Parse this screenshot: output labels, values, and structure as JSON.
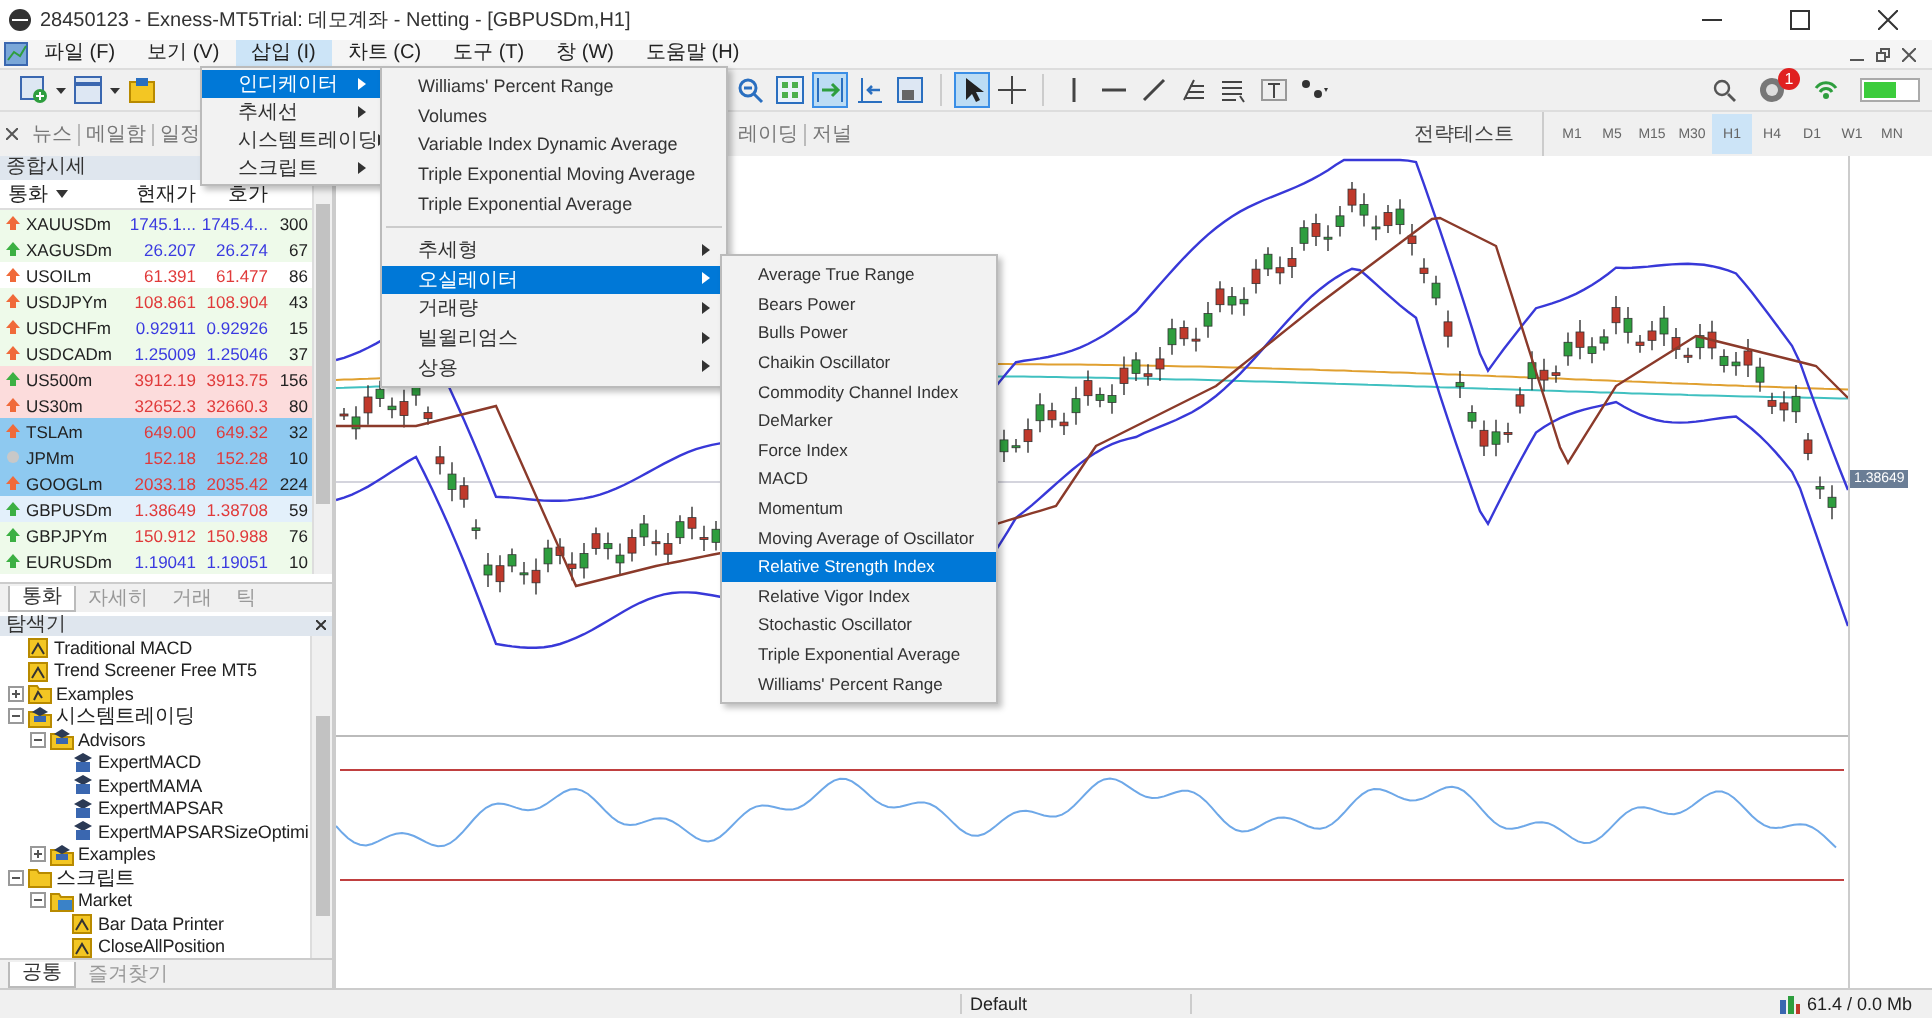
{
  "window": {
    "title": "28450123 - Exness-MT5Trial: 데모계좌 - Netting - [GBPUSDm,H1]"
  },
  "menu_bar": [
    {
      "label": "파일 (F)",
      "selected": false
    },
    {
      "label": "보기 (V)",
      "selected": false
    },
    {
      "label": "삽입 (I)",
      "selected": true
    },
    {
      "label": "차트 (C)",
      "selected": false
    },
    {
      "label": "도구 (T)",
      "selected": false
    },
    {
      "label": "창 (W)",
      "selected": false
    },
    {
      "label": "도움말 (H)",
      "selected": false
    }
  ],
  "insert_menu": {
    "items": [
      {
        "label": "인디케이터",
        "selected": true,
        "has_submenu": true
      },
      {
        "label": "추세선",
        "selected": false,
        "has_submenu": true
      },
      {
        "label": "시스템트레이딩",
        "selected": false,
        "has_submenu": true
      },
      {
        "label": "스크립트",
        "selected": false,
        "has_submenu": true
      }
    ]
  },
  "indicators_menu": {
    "items": [
      {
        "kind": "item",
        "label": "Williams' Percent Range",
        "selected": false,
        "has_submenu": false
      },
      {
        "kind": "item",
        "label": "Volumes",
        "selected": false,
        "has_submenu": false
      },
      {
        "kind": "item",
        "label": "Variable Index Dynamic Average",
        "selected": false,
        "has_submenu": false
      },
      {
        "kind": "item",
        "label": "Triple Exponential Moving Average",
        "selected": false,
        "has_submenu": false
      },
      {
        "kind": "item",
        "label": "Triple Exponential Average",
        "selected": false,
        "has_submenu": false
      },
      {
        "kind": "separator"
      },
      {
        "kind": "item",
        "label": "추세형",
        "selected": false,
        "has_submenu": true
      },
      {
        "kind": "item",
        "label": "오실레이터",
        "selected": true,
        "has_submenu": true
      },
      {
        "kind": "item",
        "label": "거래량",
        "selected": false,
        "has_submenu": true
      },
      {
        "kind": "item",
        "label": "빌윌리엄스",
        "selected": false,
        "has_submenu": true
      },
      {
        "kind": "item",
        "label": "상용",
        "selected": false,
        "has_submenu": true
      }
    ]
  },
  "oscillators_menu": {
    "items": [
      {
        "label": "Average True Range",
        "selected": false
      },
      {
        "label": "Bears Power",
        "selected": false
      },
      {
        "label": "Bulls Power",
        "selected": false
      },
      {
        "label": "Chaikin Oscillator",
        "selected": false
      },
      {
        "label": "Commodity Channel Index",
        "selected": false
      },
      {
        "label": "DeMarker",
        "selected": false
      },
      {
        "label": "Force Index",
        "selected": false
      },
      {
        "label": "MACD",
        "selected": false
      },
      {
        "label": "Momentum",
        "selected": false
      },
      {
        "label": "Moving Average of Oscillator",
        "selected": false
      },
      {
        "label": "Relative Strength Index",
        "selected": true
      },
      {
        "label": "Relative Vigor Index",
        "selected": false
      },
      {
        "label": "Stochastic Oscillator",
        "selected": false
      },
      {
        "label": "Triple Exponential Average",
        "selected": false
      },
      {
        "label": "Williams' Percent Range",
        "selected": false
      }
    ]
  },
  "toolbar": {
    "tools": [
      {
        "kind": "zoom-out",
        "on": false
      },
      {
        "kind": "tile",
        "on": false
      },
      {
        "kind": "autoscroll",
        "on": true
      },
      {
        "kind": "chart-shift",
        "on": false
      },
      {
        "kind": "template",
        "on": false
      },
      {
        "kind": "separator"
      },
      {
        "kind": "cursor",
        "on": true
      },
      {
        "kind": "crosshair",
        "on": false
      },
      {
        "kind": "separator"
      },
      {
        "kind": "vline",
        "on": false
      },
      {
        "kind": "hline",
        "on": false
      },
      {
        "kind": "trendline",
        "on": false
      },
      {
        "kind": "fibo",
        "on": false
      },
      {
        "kind": "channels",
        "on": false
      },
      {
        "kind": "text",
        "on": false
      },
      {
        "kind": "shapes",
        "on": false
      }
    ],
    "notification_badge": "1"
  },
  "toolbox_tabs_left": [
    "뉴스",
    "메일함",
    "일정"
  ],
  "toolbox_tabs_right": [
    "레이딩",
    "저널"
  ],
  "strategy_tester_tab": "전략테스트",
  "timeframes": [
    {
      "label": "M1",
      "selected": false
    },
    {
      "label": "M5",
      "selected": false
    },
    {
      "label": "M15",
      "selected": false
    },
    {
      "label": "M30",
      "selected": false
    },
    {
      "label": "H1",
      "selected": true
    },
    {
      "label": "H4",
      "selected": false
    },
    {
      "label": "D1",
      "selected": false
    },
    {
      "label": "W1",
      "selected": false
    },
    {
      "label": "MN",
      "selected": false
    }
  ],
  "market_watch": {
    "title": "종합시세",
    "columns": [
      "통화",
      "현재가",
      "호가"
    ],
    "rows": [
      {
        "symbol": "XAUUSDm",
        "arrow": {
          "kind": "up",
          "color": "#f06a3a"
        },
        "quote": {
          "bid": "1745.1...",
          "ask": "1745.4...",
          "color": "#3a3ae0"
        },
        "spread": "300",
        "color": "#eefaea",
        "selected": false
      },
      {
        "symbol": "XAGUSDm",
        "arrow": {
          "kind": "up",
          "color": "#3cb043"
        },
        "quote": {
          "bid": "26.207",
          "ask": "26.274",
          "color": "#3a3ae0"
        },
        "spread": "67",
        "color": "#eefaea",
        "selected": false
      },
      {
        "symbol": "USOILm",
        "arrow": {
          "kind": "up",
          "color": "#f06a3a"
        },
        "quote": {
          "bid": "61.391",
          "ask": "61.477",
          "color": "#e03a3a"
        },
        "spread": "86",
        "color": "#ffffff",
        "selected": false
      },
      {
        "symbol": "USDJPYm",
        "arrow": {
          "kind": "up",
          "color": "#f06a3a"
        },
        "quote": {
          "bid": "108.861",
          "ask": "108.904",
          "color": "#e03a3a"
        },
        "spread": "43",
        "color": "#eefaea",
        "selected": false
      },
      {
        "symbol": "USDCHFm",
        "arrow": {
          "kind": "up",
          "color": "#f06a3a"
        },
        "quote": {
          "bid": "0.92911",
          "ask": "0.92926",
          "color": "#3a3ae0"
        },
        "spread": "15",
        "color": "#eefaea",
        "selected": false
      },
      {
        "symbol": "USDCADm",
        "arrow": {
          "kind": "up",
          "color": "#f06a3a"
        },
        "quote": {
          "bid": "1.25009",
          "ask": "1.25046",
          "color": "#3a3ae0"
        },
        "spread": "37",
        "color": "#eefaea",
        "selected": false
      },
      {
        "symbol": "US500m",
        "arrow": {
          "kind": "up",
          "color": "#3cb043"
        },
        "quote": {
          "bid": "3912.19",
          "ask": "3913.75",
          "color": "#e03a3a"
        },
        "spread": "156",
        "color": "#fcdcdc",
        "selected": false
      },
      {
        "symbol": "US30m",
        "arrow": {
          "kind": "up",
          "color": "#f06a3a"
        },
        "quote": {
          "bid": "32652.3",
          "ask": "32660.3",
          "color": "#e03a3a"
        },
        "spread": "80",
        "color": "#fcdcdc",
        "selected": false
      },
      {
        "symbol": "TSLAm",
        "arrow": {
          "kind": "up",
          "color": "#f06a3a"
        },
        "quote": {
          "bid": "649.00",
          "ask": "649.32",
          "color": "#e03a3a"
        },
        "spread": "32",
        "selected": true
      },
      {
        "symbol": "JPMm",
        "arrow": {
          "kind": "dot",
          "color": "#c8c8c8"
        },
        "quote": {
          "bid": "152.18",
          "ask": "152.28",
          "color": "#e03a3a"
        },
        "spread": "10",
        "selected": true
      },
      {
        "symbol": "GOOGLm",
        "arrow": {
          "kind": "up",
          "color": "#f06a3a"
        },
        "quote": {
          "bid": "2033.18",
          "ask": "2035.42",
          "color": "#e03a3a"
        },
        "spread": "224",
        "selected": true
      },
      {
        "symbol": "GBPUSDm",
        "arrow": {
          "kind": "up",
          "color": "#3cb043"
        },
        "quote": {
          "bid": "1.38649",
          "ask": "1.38708",
          "color": "#e03a3a"
        },
        "spread": "59",
        "color": "#e3f0fb",
        "selected": false
      },
      {
        "symbol": "GBPJPYm",
        "arrow": {
          "kind": "up",
          "color": "#3cb043"
        },
        "quote": {
          "bid": "150.912",
          "ask": "150.988",
          "color": "#e03a3a"
        },
        "spread": "76",
        "color": "#eefaea",
        "selected": false
      },
      {
        "symbol": "EURUSDm",
        "arrow": {
          "kind": "up",
          "color": "#3cb043"
        },
        "quote": {
          "bid": "1.19041",
          "ask": "1.19051",
          "color": "#3a3ae0"
        },
        "spread": "10",
        "color": "#eefaea",
        "selected": false
      }
    ],
    "tabs": [
      {
        "label": "통화",
        "selected": true
      },
      {
        "label": "자세히",
        "selected": false
      },
      {
        "label": "거래",
        "selected": false
      },
      {
        "label": "틱",
        "selected": false
      }
    ]
  },
  "navigator": {
    "title": "탐색기",
    "tree": [
      {
        "label": "Traditional MACD",
        "kind": "indicator"
      },
      {
        "label": "Trend Screener Free MT5",
        "kind": "indicator"
      },
      {
        "label": "Examples",
        "kind": "indicator-folder",
        "expanded": false
      },
      {
        "label": "시스템트레이딩",
        "kind": "category-expert",
        "expanded": true,
        "children": [
          {
            "label": "Advisors",
            "kind": "expert-folder",
            "expanded": true,
            "children": [
              {
                "label": "ExpertMACD",
                "kind": "expert"
              },
              {
                "label": "ExpertMAMA",
                "kind": "expert"
              },
              {
                "label": "ExpertMAPSAR",
                "kind": "expert"
              },
              {
                "label": "ExpertMAPSARSizeOptimi",
                "kind": "expert"
              }
            ]
          },
          {
            "label": "Examples",
            "kind": "expert-folder",
            "expanded": false
          }
        ]
      },
      {
        "label": "스크립트",
        "kind": "category-script",
        "expanded": true,
        "children": [
          {
            "label": "Market",
            "kind": "market-folder",
            "expanded": true,
            "children": [
              {
                "label": "Bar Data Printer",
                "kind": "indicator"
              },
              {
                "label": "CloseAllPosition",
                "kind": "indicator"
              }
            ]
          }
        ]
      }
    ],
    "tabs": [
      {
        "label": "공통",
        "selected": true
      },
      {
        "label": "즐겨찾기",
        "selected": false
      }
    ]
  },
  "chart": {
    "price_label": "1.38649"
  },
  "status_bar": {
    "profile": "Default",
    "traffic": "61.4 / 0.0 Mb"
  }
}
